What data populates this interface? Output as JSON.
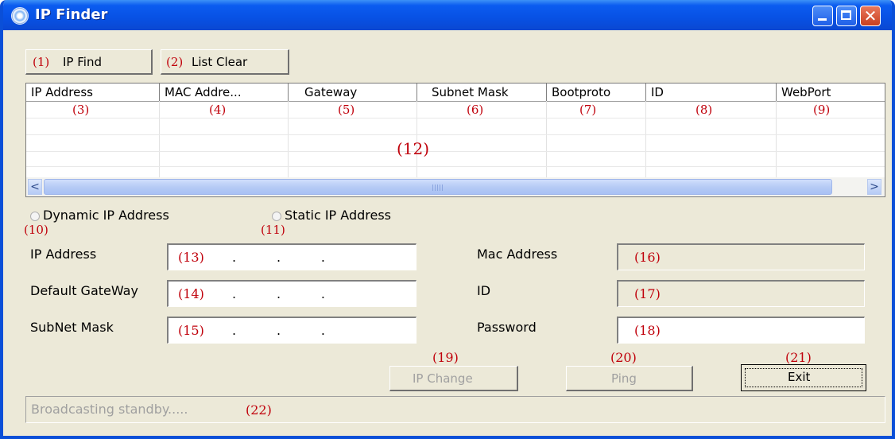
{
  "window": {
    "title": "IP Finder"
  },
  "toolbar": {
    "ip_find": {
      "num": "(1)",
      "label": "IP Find"
    },
    "list_clear": {
      "num": "(2)",
      "label": "List Clear"
    }
  },
  "list": {
    "columns": [
      {
        "label": "IP Address",
        "num": "(3)"
      },
      {
        "label": "MAC Addre...",
        "num": "(4)"
      },
      {
        "label": "Gateway",
        "num": "(5)"
      },
      {
        "label": "Subnet Mask",
        "num": "(6)"
      },
      {
        "label": "Bootproto",
        "num": "(7)"
      },
      {
        "label": "ID",
        "num": "(8)"
      },
      {
        "label": "WebPort",
        "num": "(9)"
      }
    ],
    "body_num": "(12)",
    "scroll_left": "<",
    "scroll_right": ">"
  },
  "mode": {
    "dynamic": {
      "label": "Dynamic IP Address",
      "num": "(10)"
    },
    "static": {
      "label": "Static IP Address",
      "num": "(11)"
    }
  },
  "form": {
    "ip_address": {
      "label": "IP Address",
      "num": "(13)",
      "value": ".          .          ."
    },
    "gateway": {
      "label": "Default GateWay",
      "num": "(14)",
      "value": ".          .          ."
    },
    "subnet": {
      "label": "SubNet Mask",
      "num": "(15)",
      "value": ".          .          ."
    },
    "mac": {
      "label": "Mac Address",
      "num": "(16)"
    },
    "id": {
      "label": "ID",
      "num": "(17)"
    },
    "password": {
      "label": "Password",
      "num": "(18)"
    }
  },
  "actions": {
    "ip_change": {
      "label": "IP Change",
      "num": "(19)"
    },
    "ping": {
      "label": "Ping",
      "num": "(20)"
    },
    "exit": {
      "label": "Exit",
      "num": "(21)"
    }
  },
  "status": {
    "text": "Broadcasting standby.....",
    "num": "(22)"
  }
}
